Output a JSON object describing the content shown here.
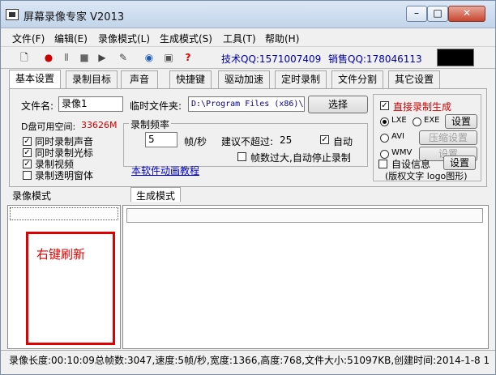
{
  "window": {
    "title": "屏幕录像专家 V2013",
    "min": "–",
    "max": "□",
    "close": "✕"
  },
  "menu": [
    "文件(F)",
    "编辑(E)",
    "录像模式(L)",
    "生成模式(S)",
    "工具(T)",
    "帮助(H)"
  ],
  "toolbar": {
    "tech_qq": "技术QQ:1571007409",
    "sales_qq": "销售QQ:178046113"
  },
  "tabs": [
    "基本设置",
    "录制目标",
    "声音",
    "快捷键",
    "驱动加速",
    "定时录制",
    "文件分割",
    "其它设置"
  ],
  "settings": {
    "filename_label": "文件名:",
    "filename_value": "录像1",
    "tempdir_label": "临时文件夹:",
    "tempdir_value": "D:\\Program Files (x86)\\",
    "choose_button": "选择",
    "disk_label": "D盘可用空间:",
    "disk_value": "33626M",
    "checks": [
      {
        "label": "同时录制声音",
        "checked": true
      },
      {
        "label": "同时录制光标",
        "checked": true
      },
      {
        "label": "录制视频",
        "checked": true
      },
      {
        "label": "录制透明窗体",
        "checked": false
      }
    ],
    "rate_group": "录制频率",
    "rate_value": "5",
    "rate_unit": "帧/秒",
    "suggest_label": "建议不超过:",
    "suggest_value": "25",
    "auto_label": "自动",
    "auto_checked": true,
    "autostop_label": "帧数过大,自动停止录制",
    "autostop_checked": false,
    "tutorial_link": "本软件动画教程",
    "direct_label": "直接录制生成",
    "direct_checked": true,
    "lxe": "LXE",
    "exe": "EXE",
    "settings_btn1": "设置",
    "avi": "AVI",
    "compress_btn": "压缩设置",
    "wmv": "WMV",
    "settings_btn2": "设置",
    "selfinfo_label": "自设信息",
    "settings_btn3": "设置",
    "copyright_note": "(版权文字 logo图形)"
  },
  "sections": {
    "record_mode": "录像模式",
    "generate_mode": "生成模式"
  },
  "left_pane": {
    "hint": "右键刷新"
  },
  "status": "录像长度:00:10:09总帧数:3047,速度:5帧/秒,宽度:1366,高度:768,文件大小:51097KB,创建时间:2014-1-8 1"
}
